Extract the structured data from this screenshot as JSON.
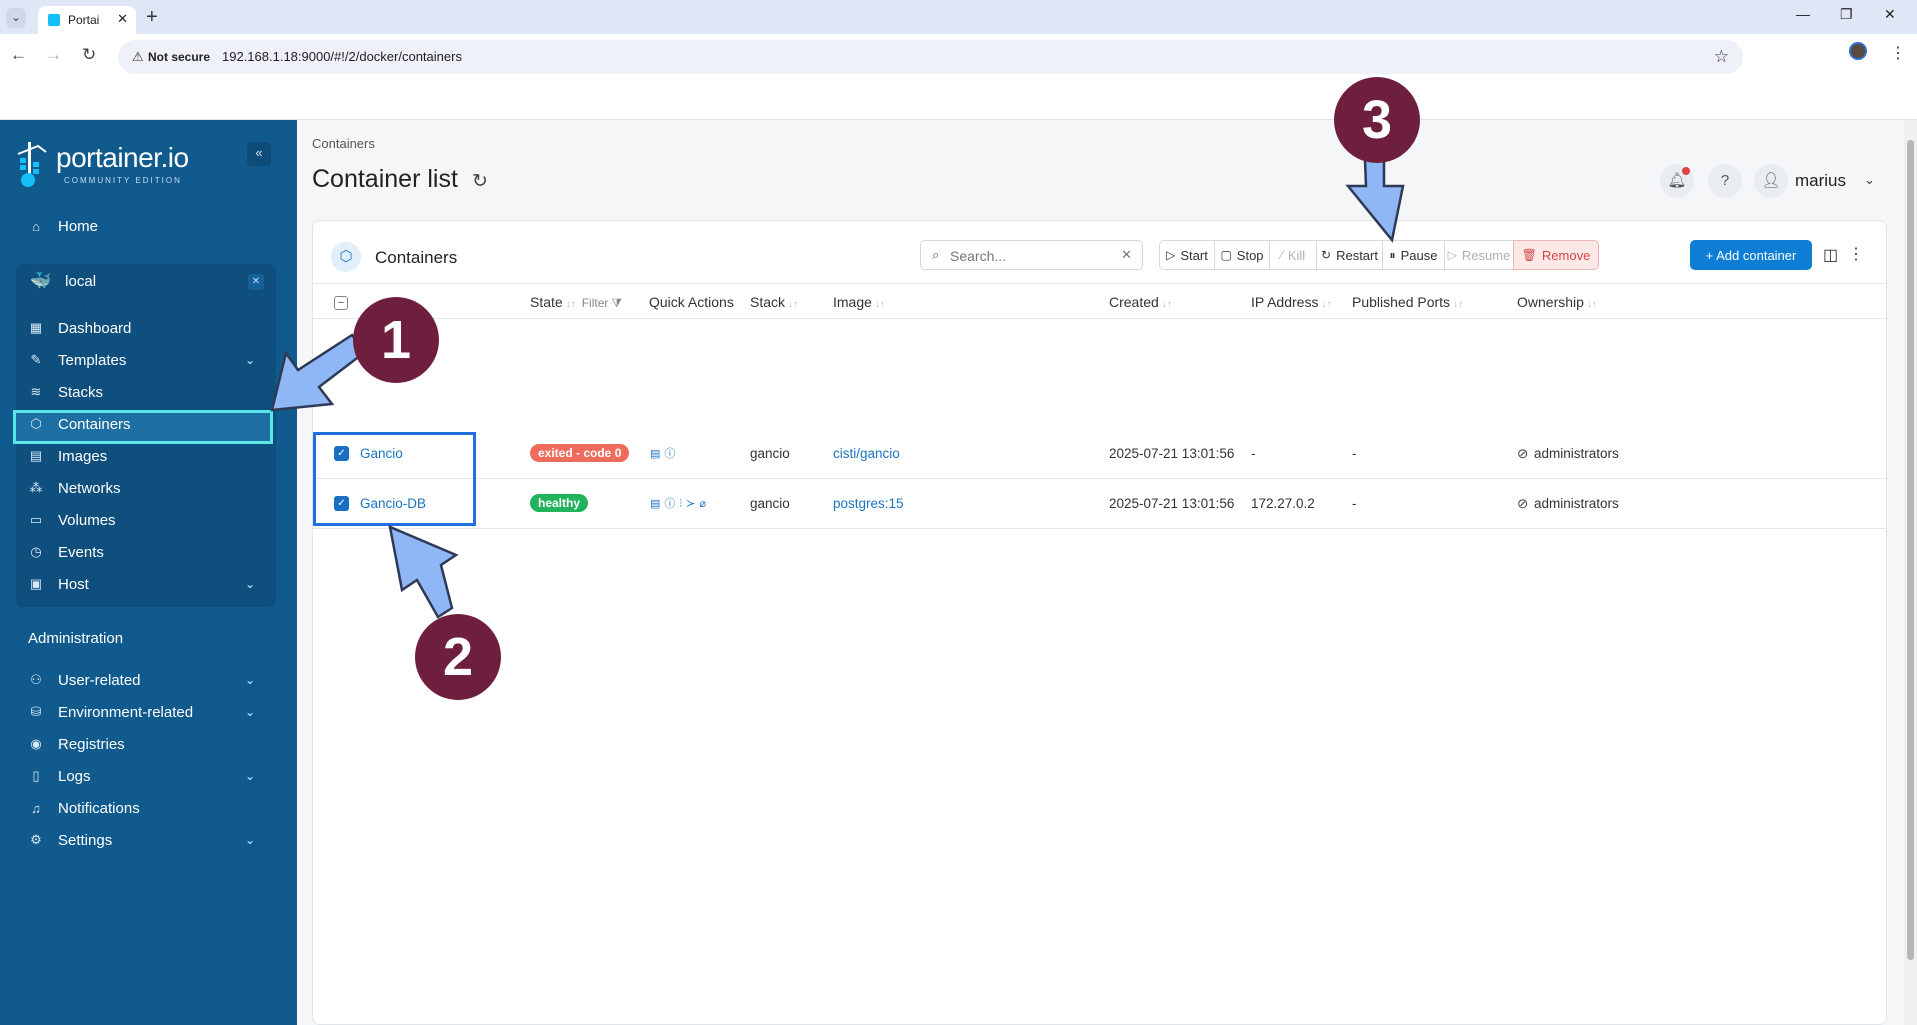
{
  "browser": {
    "tab_title": "Portai",
    "not_secure": "Not secure",
    "url": "192.168.1.18:9000/#!/2/docker/containers"
  },
  "sidebar": {
    "brand": "portainer.io",
    "edition": "COMMUNITY EDITION",
    "home": "Home",
    "environment": "local",
    "env_items": [
      {
        "label": "Dashboard",
        "icon": "dashboard-icon"
      },
      {
        "label": "Templates",
        "icon": "templates-icon"
      },
      {
        "label": "Stacks",
        "icon": "stacks-icon"
      },
      {
        "label": "Containers",
        "icon": "containers-icon"
      },
      {
        "label": "Images",
        "icon": "images-icon"
      },
      {
        "label": "Networks",
        "icon": "networks-icon"
      },
      {
        "label": "Volumes",
        "icon": "volumes-icon"
      },
      {
        "label": "Events",
        "icon": "events-icon"
      },
      {
        "label": "Host",
        "icon": "host-icon"
      }
    ],
    "admin_heading": "Administration",
    "admin_items": [
      {
        "label": "User-related"
      },
      {
        "label": "Environment-related"
      },
      {
        "label": "Registries"
      },
      {
        "label": "Logs"
      },
      {
        "label": "Notifications"
      },
      {
        "label": "Settings"
      }
    ]
  },
  "header": {
    "breadcrumb": "Containers",
    "title": "Container list",
    "username": "marius"
  },
  "card": {
    "title": "Containers",
    "search_placeholder": "Search...",
    "actions": {
      "start": "Start",
      "stop": "Stop",
      "kill": "Kill",
      "restart": "Restart",
      "pause": "Pause",
      "resume": "Resume",
      "remove": "Remove",
      "add": "+ Add container"
    },
    "columns": {
      "state": "State",
      "filter": "Filter",
      "quick_actions": "Quick Actions",
      "stack": "Stack",
      "image": "Image",
      "created": "Created",
      "ip": "IP Address",
      "ports": "Published Ports",
      "ownership": "Ownership"
    },
    "rows": [
      {
        "name": "Gancio",
        "state": "exited - code 0",
        "stack": "gancio",
        "image": "cisti/gancio",
        "created": "2025-07-21 13:01:56",
        "ip": "-",
        "ports": "-",
        "ownership": "administrators"
      },
      {
        "name": "Gancio-DB",
        "state": "healthy",
        "stack": "gancio",
        "image": "postgres:15",
        "created": "2025-07-21 13:01:56",
        "ip": "172.27.0.2",
        "ports": "-",
        "ownership": "administrators"
      }
    ]
  },
  "callouts": [
    "1",
    "2",
    "3"
  ],
  "colors": {
    "sidebar": "#105a8e",
    "accent": "#0e7ed4",
    "exited": "#ef6b5b",
    "healthy": "#20b35c",
    "callout": "#6e1f3e",
    "arrow": "#8fb6f5"
  }
}
